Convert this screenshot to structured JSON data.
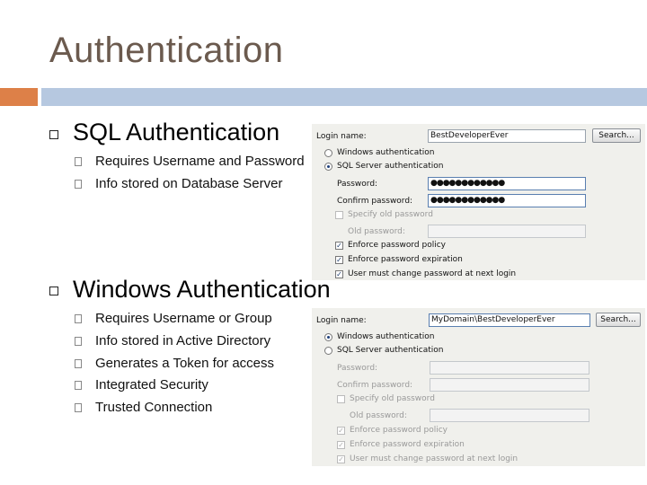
{
  "slide": {
    "title": "Authentication",
    "section1": {
      "heading": "SQL Authentication",
      "bullets": [
        "Requires Username and Password",
        "Info stored on Database Server"
      ]
    },
    "section2": {
      "heading": "Windows Authentication",
      "bullets": [
        "Requires Username or Group",
        "Info stored in Active Directory",
        "Generates a Token for access",
        "Integrated Security",
        "Trusted Connection"
      ]
    }
  },
  "dialog_sql": {
    "login_name_label": "Login name:",
    "login_name_value": "BestDeveloperEver",
    "search_button": "Search...",
    "windows_auth": "Windows authentication",
    "sql_auth": "SQL Server authentication",
    "password_label": "Password:",
    "password_value": "●●●●●●●●●●●●",
    "confirm_label": "Confirm password:",
    "confirm_value": "●●●●●●●●●●●●",
    "specify_old": "Specify old password",
    "old_password_label": "Old password:",
    "enforce_policy": "Enforce password policy",
    "enforce_expiration": "Enforce password expiration",
    "must_change": "User must change password at next login",
    "check_glyph": "✓"
  },
  "dialog_win": {
    "login_name_label": "Login name:",
    "login_name_value": "MyDomain\\BestDeveloperEver",
    "search_button": "Search...",
    "windows_auth": "Windows authentication",
    "sql_auth": "SQL Server authentication",
    "password_label": "Password:",
    "confirm_label": "Confirm password:",
    "specify_old": "Specify old password",
    "old_password_label": "Old password:",
    "enforce_policy": "Enforce password policy",
    "enforce_expiration": "Enforce password expiration",
    "must_change": "User must change password at next login",
    "check_glyph": "✓"
  },
  "colors": {
    "title": "#6b5a4e",
    "accent_orange": "#dd8048",
    "accent_blue": "#b6c8e0"
  }
}
